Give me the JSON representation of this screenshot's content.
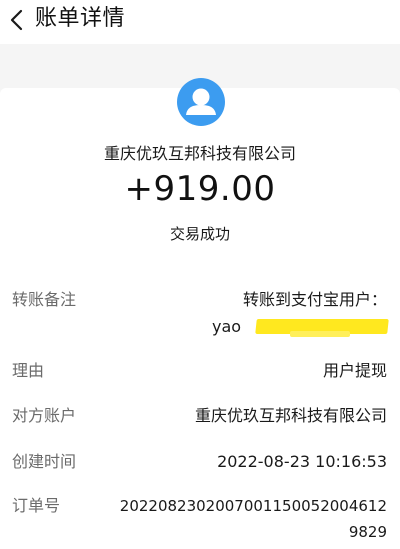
{
  "header": {
    "title": "账单详情"
  },
  "merchant": {
    "name": "重庆优玖互邦科技有限公司",
    "avatar_icon": "user-avatar-icon",
    "avatar_color": "#3c9cf0"
  },
  "amount": "+919.00",
  "status": "交易成功",
  "details": {
    "note_label": "转账备注",
    "note_value_line1": "转账到支付宝用户：",
    "note_value_line2_prefix": "yao",
    "reason_label": "理由",
    "reason_value": "用户提现",
    "party_label": "对方账户",
    "party_value": "重庆优玖互邦科技有限公司",
    "time_label": "创建时间",
    "time_value": "2022-08-23 10:16:53",
    "order_label": "订单号",
    "order_value_line1": "2022082302007001150052004612",
    "order_value_line2": "9829"
  }
}
